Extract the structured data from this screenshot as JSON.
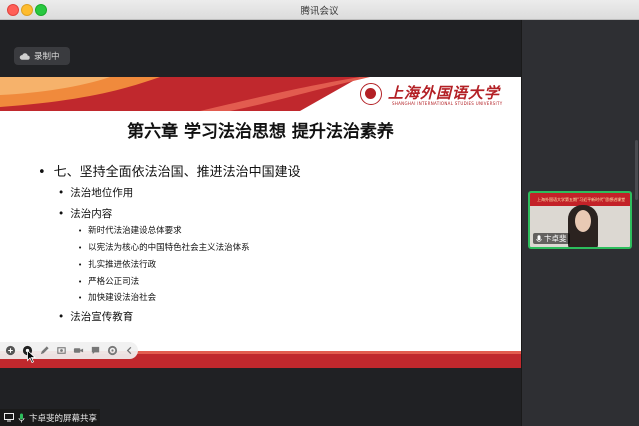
{
  "window": {
    "title": "腾讯会议"
  },
  "recording": {
    "label": "录制中",
    "icon": "cloud-record-icon"
  },
  "slide": {
    "logo_cn": "上海外国语大学",
    "logo_en": "SHANGHAI INTERNATIONAL STUDIES UNIVERSITY",
    "title": "第六章 学习法治思想 提升法治素养",
    "bullets": {
      "l1": "七、坚持全面依法治国、推进法治中国建设",
      "l2_a": "法治地位作用",
      "l2_b": "法治内容",
      "l3": [
        "新时代法治建设总体要求",
        "以宪法为核心的中国特色社会主义法治体系",
        "扎实推进依法行政",
        "严格公正司法",
        "加快建设法治社会"
      ],
      "l2_c": "法治宣传教育"
    },
    "colors": {
      "brand_red": "#c0282d",
      "accent_orange": "#f08a3c"
    }
  },
  "annotation_toolbar": {
    "icons": [
      "add-icon",
      "pointer-icon",
      "pen-icon",
      "screenshot-icon",
      "video-icon",
      "comment-icon",
      "settings-icon",
      "collapse-icon"
    ]
  },
  "share_status": {
    "label": "卞卓斐的屏幕共享",
    "icons": [
      "screen-share-icon",
      "mic-icon"
    ]
  },
  "participant": {
    "name": "卞卓斐",
    "banner_text": "上海外国语大学第五期“习近平新时代”思想进课堂",
    "active_color": "#2dbd5c"
  }
}
